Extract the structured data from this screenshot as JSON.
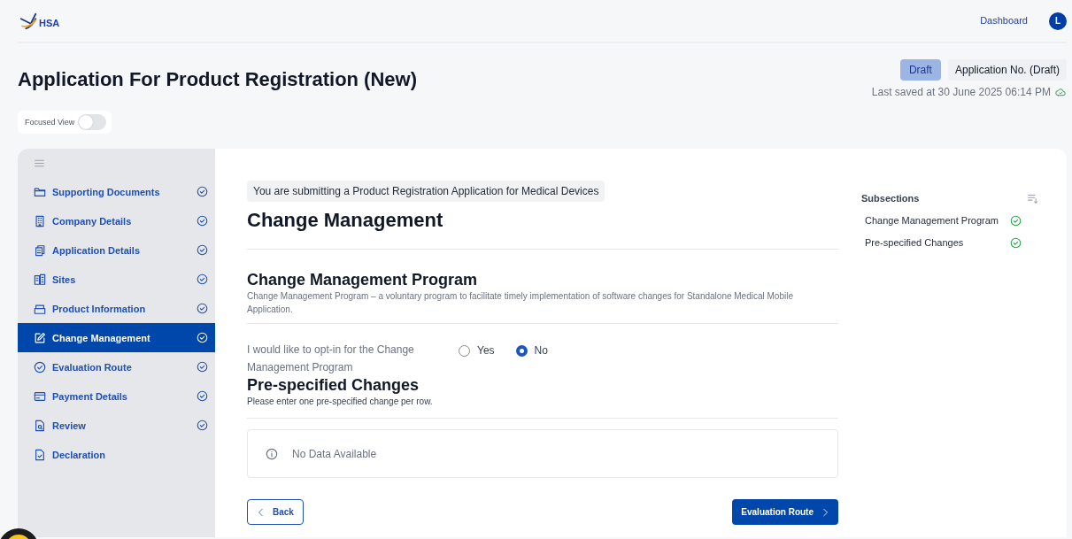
{
  "header": {
    "logo_text": "HSA",
    "nav_link": "Dashboard",
    "avatar_initial": "L"
  },
  "page": {
    "title": "Application For Product Registration (New)",
    "status_badge": "Draft",
    "application_no": "Application No. (Draft)",
    "last_saved": "Last saved at 30 June 2025 06:14 PM",
    "focused_view": {
      "label": "Focused View",
      "on": false
    }
  },
  "sidebar": {
    "items": [
      {
        "label": "Supporting Documents",
        "selected": false,
        "completed": true
      },
      {
        "label": "Company Details",
        "selected": false,
        "completed": true
      },
      {
        "label": "Application Details",
        "selected": false,
        "completed": true
      },
      {
        "label": "Sites",
        "selected": false,
        "completed": true
      },
      {
        "label": "Product Information",
        "selected": false,
        "completed": true
      },
      {
        "label": "Change Management",
        "selected": true,
        "completed": true
      },
      {
        "label": "Evaluation Route",
        "selected": false,
        "completed": true
      },
      {
        "label": "Payment Details",
        "selected": false,
        "completed": true
      },
      {
        "label": "Review",
        "selected": false,
        "completed": true
      },
      {
        "label": "Declaration",
        "selected": false,
        "completed": false
      }
    ]
  },
  "content": {
    "notice": "You are submitting a Product Registration Application for Medical Devices",
    "heading": "Change Management",
    "program": {
      "title": "Change Management Program",
      "description": "Change Management Program – a voluntary program to facilitate timely implementation of software changes for Standalone Medical Mobile Application.",
      "question": "I would like to opt-in for the Change Management Program",
      "options": [
        {
          "label": "Yes",
          "selected": false
        },
        {
          "label": "No",
          "selected": true
        }
      ]
    },
    "prespecified": {
      "title": "Pre-specified Changes",
      "description": "Please enter one pre-specified change per row.",
      "empty_message": "No Data Available"
    },
    "back_button": "Back",
    "next_button": "Evaluation Route"
  },
  "subsections": {
    "title": "Subsections",
    "items": [
      {
        "label": "Change Management Program",
        "completed": true
      },
      {
        "label": "Pre-specified Changes",
        "completed": true
      }
    ]
  }
}
